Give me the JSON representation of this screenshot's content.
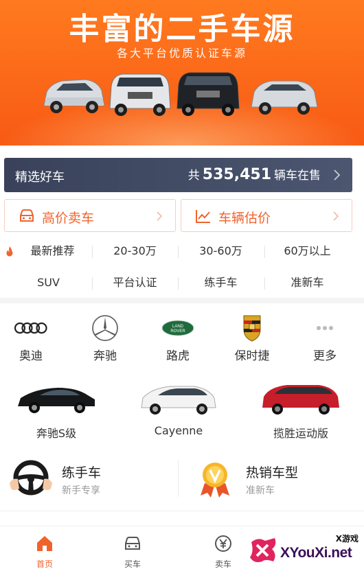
{
  "banner": {
    "title": "丰富的二手车源",
    "subtitle": "各大平台优质认证车源"
  },
  "featured": {
    "label": "精选好车",
    "prefix": "共",
    "count": "535,451",
    "suffix": "辆车在售"
  },
  "actions": {
    "sell": "高价卖车",
    "evaluate": "车辆估价"
  },
  "filters": {
    "row1": [
      "最新推荐",
      "20-30万",
      "30-60万",
      "60万以上"
    ],
    "row2": [
      "SUV",
      "平台认证",
      "练手车",
      "准新车"
    ]
  },
  "brands": [
    "奥迪",
    "奔驰",
    "路虎",
    "保时捷",
    "更多"
  ],
  "brand_logo_text": {
    "landrover": "LAND ROVER"
  },
  "models": [
    "奔驰S级",
    "Cayenne",
    "揽胜运动版"
  ],
  "promos": [
    {
      "title": "练手车",
      "subtitle": "新手专享"
    },
    {
      "title": "热销车型",
      "subtitle": "准新车"
    }
  ],
  "tabs": [
    "首页",
    "买车",
    "卖车"
  ],
  "watermark": {
    "site": "XYouXi.net",
    "tag": "X游戏"
  },
  "colors": {
    "accent": "#f0632d",
    "banner": "#f85a14",
    "featured_bg": "#3e4760"
  }
}
